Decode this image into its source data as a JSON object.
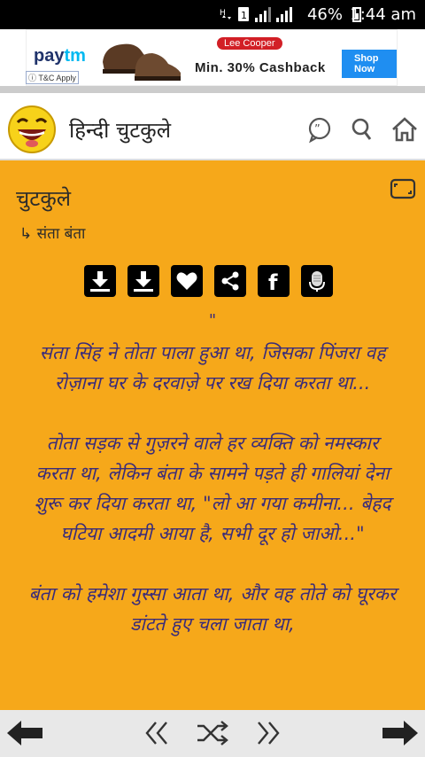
{
  "status": {
    "time": "1:44 am",
    "battery": "46%"
  },
  "ad": {
    "brand": "Paytm",
    "brand_part1": "pay",
    "brand_part2": "tm",
    "partner": "Lee Cooper",
    "offer": "Min. 30% Cashback",
    "cta": "Shop Now",
    "tnc": "T&C Apply"
  },
  "appbar": {
    "title": "हिन्दी चुटकुले"
  },
  "content": {
    "category": "चुटकुले",
    "subcategory_arrow": "↳",
    "subcategory": "संता बंता",
    "quote_mark": "\"",
    "paragraphs": [
      "संता सिंह ने तोता पाला हुआ था, जिसका पिंजरा वह रोज़ाना घर के दरवाज़े पर रख दिया करता था...",
      "तोता सड़क से गुज़रने वाले हर व्यक्ति को नमस्कार करता था, लेकिन बंता के सामने पड़ते ही गालियां देना शुरू कर दिया करता था, \"लो आ गया कमीना... बेहद घटिया आदमी आया है, सभी दूर हो जाओ...\"",
      "बंता को हमेशा गुस्सा आता था, और वह तोते को घूरकर डांटते हुए चला जाता था,"
    ]
  },
  "icons": {
    "download1": "download-icon",
    "download2": "download-icon",
    "favorite": "heart-icon",
    "share": "share-icon",
    "facebook": "facebook-icon",
    "mic": "microphone-icon"
  },
  "colors": {
    "background": "#f6a81a",
    "text": "#3a2c7a",
    "appbar": "#ffffff"
  }
}
